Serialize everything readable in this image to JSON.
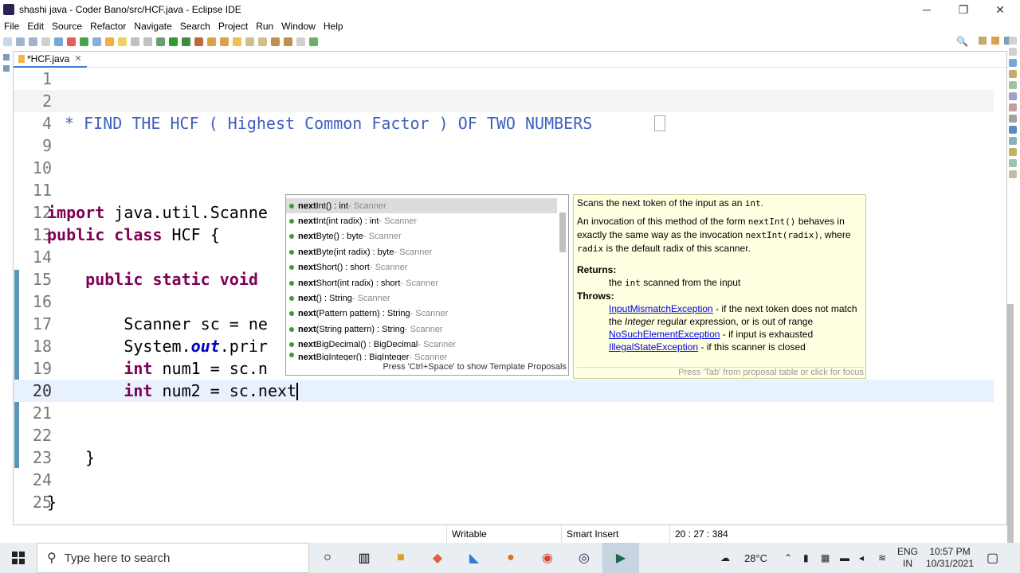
{
  "window": {
    "title": "shashi java - Coder Bano/src/HCF.java - Eclipse IDE",
    "minimize": "─",
    "maximize": "❐",
    "close": "✕"
  },
  "menu": [
    "File",
    "Edit",
    "Source",
    "Refactor",
    "Navigate",
    "Search",
    "Project",
    "Run",
    "Window",
    "Help"
  ],
  "editor": {
    "tab_label": "*HCF.java",
    "tab_close": "✕",
    "lines": [
      {
        "num": "1",
        "text": ""
      },
      {
        "num": "2",
        "text": ""
      },
      {
        "num": "4",
        "text": " * FIND THE HCF ( Highest Common Factor ) OF TWO NUMBERS"
      },
      {
        "num": "9",
        "text": ""
      },
      {
        "num": "10",
        "text": ""
      },
      {
        "num": "11",
        "text": ""
      },
      {
        "num": "12",
        "kw": "import",
        "text": " java.util.Scanne"
      },
      {
        "num": "13",
        "kw": "public class",
        "text": " HCF {"
      },
      {
        "num": "14",
        "text": ""
      },
      {
        "num": "15",
        "kw": "    public static void",
        "text": ""
      },
      {
        "num": "16",
        "text": ""
      },
      {
        "num": "17",
        "text": "        Scanner sc = ne"
      },
      {
        "num": "18",
        "pre": "        System.",
        "ital": "out",
        "text": ".prir"
      },
      {
        "num": "19",
        "kw": "        int",
        "text": " num1 = sc.n"
      },
      {
        "num": "20",
        "kw": "        int",
        "text": " num2 = sc.next"
      },
      {
        "num": "21",
        "text": ""
      },
      {
        "num": "22",
        "text": ""
      },
      {
        "num": "23",
        "text": "    }"
      },
      {
        "num": "24",
        "text": ""
      },
      {
        "num": "25",
        "text": "}"
      }
    ]
  },
  "autocomplete": {
    "items": [
      {
        "bold": "next",
        "rest": "Int() : int",
        "type": " - Scanner"
      },
      {
        "bold": "next",
        "rest": "Int(int radix) : int",
        "type": " - Scanner"
      },
      {
        "bold": "next",
        "rest": "Byte() : byte",
        "type": " - Scanner"
      },
      {
        "bold": "next",
        "rest": "Byte(int radix) : byte",
        "type": " - Scanner"
      },
      {
        "bold": "next",
        "rest": "Short() : short",
        "type": " - Scanner"
      },
      {
        "bold": "next",
        "rest": "Short(int radix) : short",
        "type": " - Scanner"
      },
      {
        "bold": "next",
        "rest": "() : String",
        "type": " - Scanner"
      },
      {
        "bold": "next",
        "rest": "(Pattern pattern) : String",
        "type": " - Scanner"
      },
      {
        "bold": "next",
        "rest": "(String pattern) : String",
        "type": " - Scanner"
      },
      {
        "bold": "next",
        "rest": "BigDecimal() : BigDecimal",
        "type": " - Scanner"
      },
      {
        "bold": "next",
        "rest": "BigInteger() : BigInteger",
        "type": " - Scanner"
      }
    ],
    "footer": "Press 'Ctrl+Space' to show Template Proposals"
  },
  "javadoc": {
    "summary_a": "Scans the next token of the input as an ",
    "summary_code": "int",
    "summary_b": ".",
    "para_a": "An invocation of this method of the form ",
    "para_code1": "nextInt()",
    "para_b": " behaves in exactly the same way as the invocation ",
    "para_code2": "nextInt(radix)",
    "para_c": ", where ",
    "para_code3": "radix",
    "para_d": " is the default radix of this scanner.",
    "returns_label": "Returns:",
    "returns_a": "the ",
    "returns_code": "int",
    "returns_b": " scanned from the input",
    "throws_label": "Throws:",
    "throws": [
      {
        "link": "InputMismatchException",
        "text1": " - if the next token does not match the ",
        "ital": "Integer",
        "text2": " regular expression, or is out of range"
      },
      {
        "link": "NoSuchElementException",
        "text1": " - if input is exhausted",
        "ital": "",
        "text2": ""
      },
      {
        "link": "IllegalStateException",
        "text1": " - if this scanner is closed",
        "ital": "",
        "text2": ""
      }
    ],
    "hint": "Press 'Tab' from proposal table or click for focus"
  },
  "status": {
    "writable": "Writable",
    "insert_mode": "Smart Insert",
    "position": "20 : 27 : 384"
  },
  "taskbar": {
    "search_placeholder": "Type here to search",
    "weather": "28°C",
    "lang1": "ENG",
    "lang2": "IN",
    "time": "10:57 PM",
    "date": "10/31/2021"
  }
}
